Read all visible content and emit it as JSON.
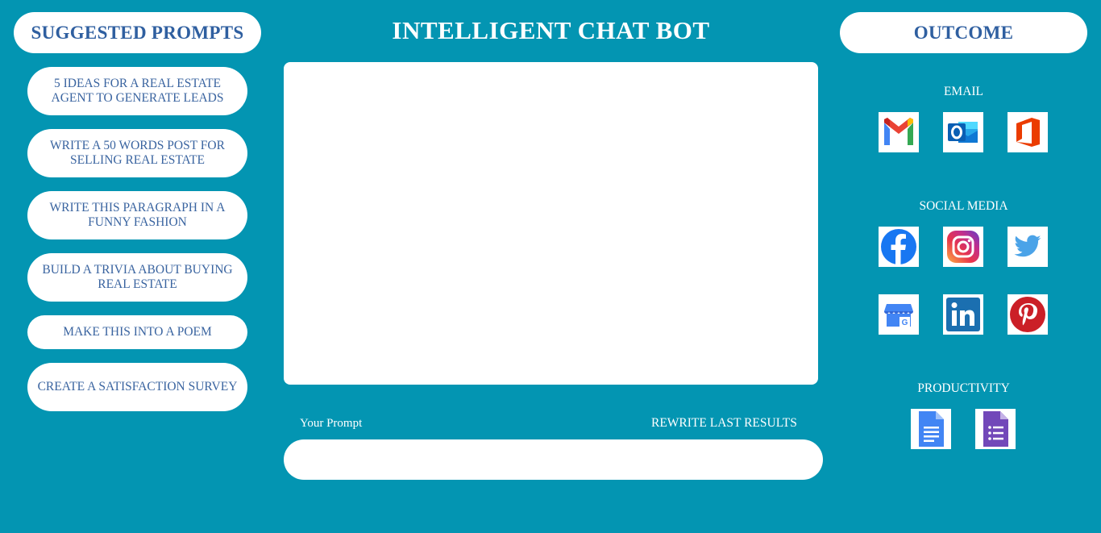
{
  "left_panel": {
    "heading": "SUGGESTED PROMPTS",
    "prompts": [
      "5 IDEAS FOR A REAL ESTATE AGENT TO GENERATE LEADS",
      "WRITE A 50 WORDS POST FOR SELLING REAL ESTATE",
      "WRITE THIS PARAGRAPH IN A FUNNY FASHION",
      "BUILD A TRIVIA ABOUT BUYING REAL ESTATE",
      "MAKE THIS INTO A POEM",
      "CREATE A SATISFACTION SURVEY"
    ]
  },
  "main": {
    "title": "INTELLIGENT CHAT BOT",
    "output_text": "",
    "prompt_label": "Your Prompt",
    "rewrite_label": "REWRITE LAST RESULTS",
    "prompt_value": "",
    "prompt_placeholder": ""
  },
  "right_panel": {
    "heading": "OUTCOME",
    "sections": {
      "email": {
        "label": "EMAIL",
        "icons": [
          "gmail-icon",
          "outlook-icon",
          "office-icon"
        ]
      },
      "social": {
        "label": "SOCIAL MEDIA",
        "icons": [
          "facebook-icon",
          "instagram-icon",
          "twitter-icon",
          "google-business-icon",
          "linkedin-icon",
          "pinterest-icon"
        ]
      },
      "productivity": {
        "label": "PRODUCTIVITY",
        "icons": [
          "google-docs-icon",
          "google-forms-icon"
        ]
      }
    }
  },
  "colors": {
    "background": "#0395b2",
    "heading_text": "#2f5fa0",
    "panel": "#ffffff"
  }
}
